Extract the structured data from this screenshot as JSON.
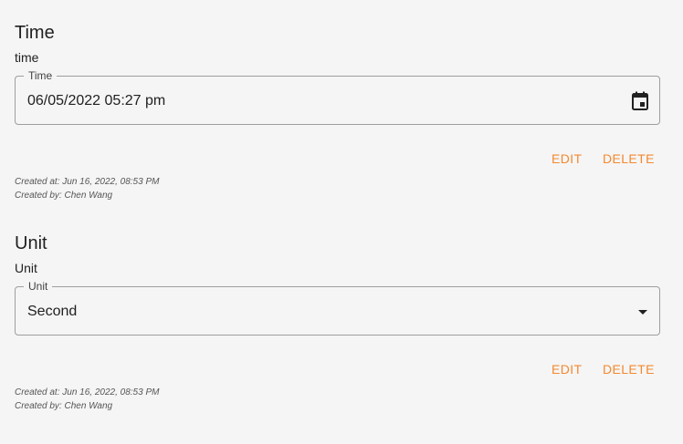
{
  "sections": [
    {
      "title": "Time",
      "description": "time",
      "field_label": "Time",
      "field_value": "06/05/2022 05:27 pm",
      "edit_label": "EDIT",
      "delete_label": "DELETE",
      "created_at": "Created at: Jun 16, 2022, 08:53 PM",
      "created_by": "Created by: Chen Wang",
      "icon": "calendar-icon"
    },
    {
      "title": "Unit",
      "description": "Unit",
      "field_label": "Unit",
      "field_value": "Second",
      "edit_label": "EDIT",
      "delete_label": "DELETE",
      "created_at": "Created at: Jun 16, 2022, 08:53 PM",
      "created_by": "Created by: Chen Wang",
      "icon": "dropdown-arrow-icon"
    }
  ],
  "colors": {
    "accent": "#f4892f",
    "background": "#f5f5f5",
    "border": "#9e9e9e"
  }
}
